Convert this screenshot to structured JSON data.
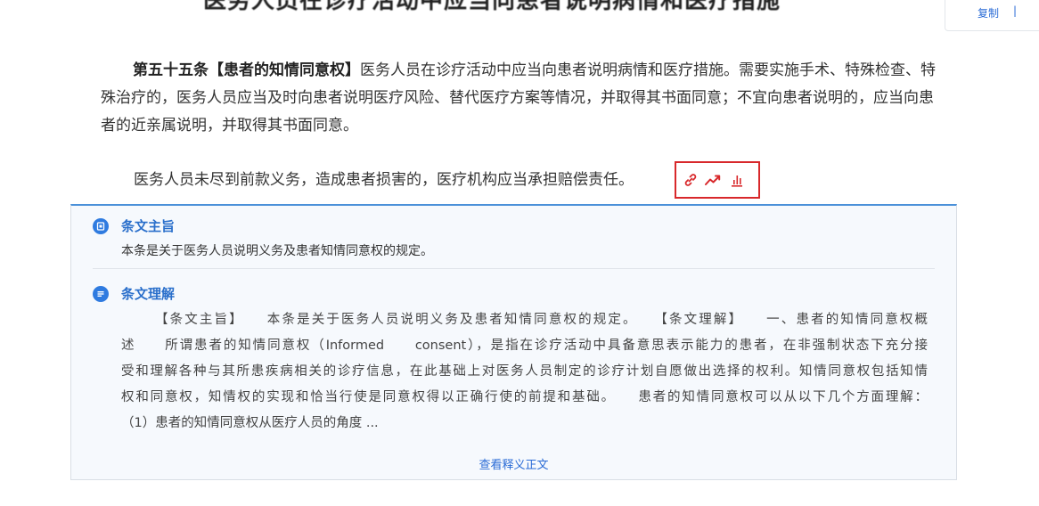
{
  "header": {
    "cropped_title": "医务人员在诊疗活动中应当向患者说明病情和医疗措施"
  },
  "toolbar": {
    "copy_label": "复制",
    "separator": "|"
  },
  "article": {
    "number_title": "第五十五条【患者的知情同意权】",
    "para1_body": "医务人员在诊疗活动中应当向患者说明病情和医疗措施。需要实施手术、特殊检查、特殊治疗的，医务人员应当及时向患者说明医疗风险、替代医疗方案等情况，并取得其书面同意；不宜向患者说明的，应当向患者的近亲属说明，并取得其书面同意。",
    "para2": "医务人员未尽到前款义务，造成患者损害的，医疗机构应当承担赔偿责任。",
    "tool_icons": [
      "link-icon",
      "trend-icon",
      "chart-icon"
    ],
    "tool_color": "#d8282b"
  },
  "card": {
    "accent_color": "#2f7be0",
    "section1": {
      "title": "条文主旨",
      "text": "本条是关于医务人员说明义务及患者知情同意权的规定。"
    },
    "section2": {
      "title": "条文理解",
      "lines": [
        "【条文主旨】　　本条是关于医务人员说明义务及患者知情同意权的规定。　　【条文理解】　　一、患者的知情同意权概",
        "述　　所谓患者的知情同意权（Informed　　consent），是指在诊疗活动中具备意思表示能力的患者，在非强制状态下充分接",
        "受和理解各种与其所患疾病相关的诊疗信息，在此基础上对医务人员制定的诊疗计划自愿做出选择的权利。知情同意权包括知情",
        "权和同意权，知情权的实现和恰当行使是同意权得以正确行使的前提和基础。　　患者的知情同意权可以从以下几个方面理解：",
        "（1）患者的知情同意权从医疗人员的角度 ..."
      ]
    },
    "view_more_label": "查看释义正文"
  }
}
